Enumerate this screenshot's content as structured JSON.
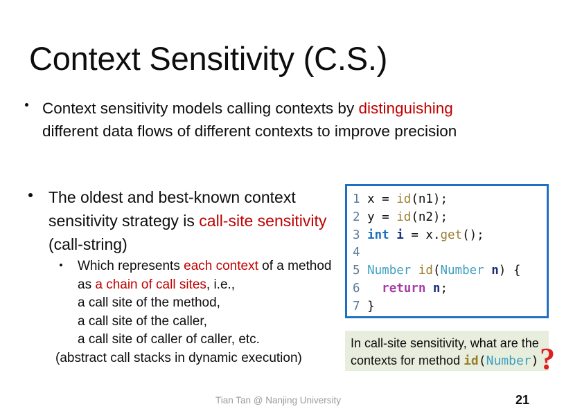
{
  "slide": {
    "title": "Context Sensitivity (C.S.)",
    "accent_red": "#c00000",
    "code_border": "#1f70c1",
    "callout_bg": "#e7eedd"
  },
  "bullet1": {
    "seg1": "Context sensitivity models calling contexts by ",
    "seg2_red": "distinguishing",
    "seg3": "different data flows of different contexts to improve precision"
  },
  "bullet2": {
    "seg1": "The oldest and best-known context sensitivity strategy is ",
    "seg2_red": "call-site sensitivity",
    "seg3": " (call-string)"
  },
  "subbullet": {
    "line1_a": "Which represents ",
    "line1_red": "each context",
    "line1_b": " of a method as ",
    "line1_red2": "a chain of call sites",
    "line1_c": ", i.e.,",
    "line2": "a call site of the method,",
    "line3": "a call site of the caller,",
    "line4": "a call site of caller of caller, etc.",
    "line5": "(abstract call stacks in dynamic execution)"
  },
  "code": {
    "lines": [
      {
        "no": "1",
        "tokens": [
          {
            "t": " x = ",
            "c": "c-plain"
          },
          {
            "t": "id",
            "c": "c-method"
          },
          {
            "t": "(n1);",
            "c": "c-plain"
          }
        ]
      },
      {
        "no": "2",
        "tokens": [
          {
            "t": " y = ",
            "c": "c-plain"
          },
          {
            "t": "id",
            "c": "c-method"
          },
          {
            "t": "(n2);",
            "c": "c-plain"
          }
        ]
      },
      {
        "no": "3",
        "tokens": [
          {
            "t": " ",
            "c": "c-plain"
          },
          {
            "t": "int",
            "c": "c-kw"
          },
          {
            "t": " ",
            "c": "c-plain"
          },
          {
            "t": "i",
            "c": "c-var"
          },
          {
            "t": " = x.",
            "c": "c-plain"
          },
          {
            "t": "get",
            "c": "c-method"
          },
          {
            "t": "();",
            "c": "c-plain"
          }
        ]
      },
      {
        "no": "4",
        "tokens": [
          {
            "t": "",
            "c": "c-plain"
          }
        ]
      },
      {
        "no": "5",
        "tokens": [
          {
            "t": " ",
            "c": "c-plain"
          },
          {
            "t": "Number",
            "c": "c-type"
          },
          {
            "t": " ",
            "c": "c-plain"
          },
          {
            "t": "id",
            "c": "c-method"
          },
          {
            "t": "(",
            "c": "c-plain"
          },
          {
            "t": "Number",
            "c": "c-type"
          },
          {
            "t": " ",
            "c": "c-plain"
          },
          {
            "t": "n",
            "c": "c-var"
          },
          {
            "t": ") {",
            "c": "c-plain"
          }
        ]
      },
      {
        "no": "6",
        "tokens": [
          {
            "t": "   ",
            "c": "c-plain"
          },
          {
            "t": "return",
            "c": "c-return"
          },
          {
            "t": " ",
            "c": "c-plain"
          },
          {
            "t": "n",
            "c": "c-var"
          },
          {
            "t": ";",
            "c": "c-plain"
          }
        ]
      },
      {
        "no": "7",
        "tokens": [
          {
            "t": " }",
            "c": "c-plain"
          }
        ]
      }
    ]
  },
  "callout": {
    "line1": "In call-site sensitivity, what are the",
    "line2_a": "contexts for method ",
    "line2_id": "id",
    "line2_open": "(",
    "line2_type": "Number",
    "line2_close": ")",
    "question_mark": "?"
  },
  "footer": {
    "credit": "Tian Tan @ Nanjing University",
    "page": "21"
  }
}
